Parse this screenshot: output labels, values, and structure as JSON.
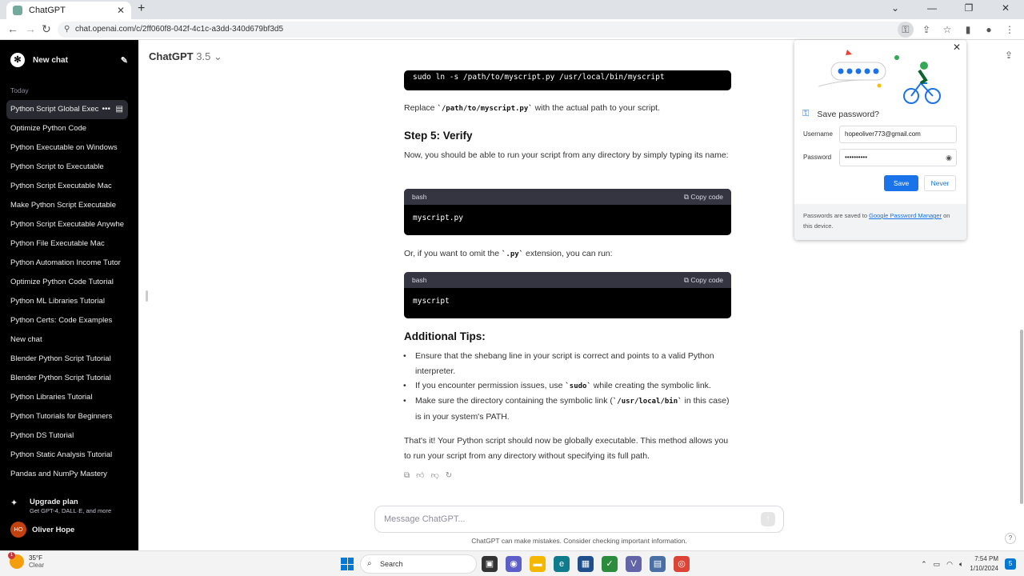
{
  "browser": {
    "tab_title": "ChatGPT",
    "url": "chat.openai.com/c/2ff060f8-042f-4c1c-a3dd-340d679bf3d5"
  },
  "sidebar": {
    "new_chat": "New chat",
    "section_today": "Today",
    "chats": [
      "Python Script Global Exec",
      "Optimize Python Code",
      "Python Executable on Windows",
      "Python Script to Executable",
      "Python Script Executable Mac",
      "Make Python Script Executable",
      "Python Script Executable Anywhe",
      "Python File Executable Mac",
      "Python Automation Income Tutor",
      "Optimize Python Code Tutorial",
      "Python ML Libraries Tutorial",
      "Python Certs: Code Examples",
      "New chat",
      "Blender Python Script Tutorial",
      "Blender Python Script Tutorial",
      "Python Libraries Tutorial",
      "Python Tutorials for Beginners",
      "Python DS Tutorial",
      "Python Static Analysis Tutorial",
      "Pandas and NumPy Mastery"
    ],
    "upgrade_title": "Upgrade plan",
    "upgrade_sub": "Get GPT-4, DALL·E, and more",
    "user_initials": "HO",
    "user_name": "Oliver Hope"
  },
  "header": {
    "model": "ChatGPT",
    "version": "3.5"
  },
  "content": {
    "code1": "sudo ln -s /path/to/myscript.py /usr/local/bin/myscript",
    "replace_pre": "Replace ",
    "replace_code": "`/path/to/myscript.py`",
    "replace_post": " with the actual path to your script.",
    "step5": "Step 5: Verify",
    "verify_text": "Now, you should be able to run your script from any directory by simply typing its name:",
    "lang": "bash",
    "copy_label": "Copy code",
    "code2": "myscript.py",
    "omit_pre": "Or, if you want to omit the ",
    "omit_code": "`.py`",
    "omit_post": " extension, you can run:",
    "code3": "myscript",
    "tips_heading": "Additional Tips:",
    "tip1": "Ensure that the shebang line in your script is correct and points to a valid Python interpreter.",
    "tip2_pre": "If you encounter permission issues, use ",
    "tip2_code": "`sudo`",
    "tip2_post": " while creating the symbolic link.",
    "tip3_pre": "Make sure the directory containing the symbolic link (",
    "tip3_code": "`/usr/local/bin`",
    "tip3_post": " in this case) is in your system's PATH.",
    "conclusion": "That's it! Your Python script should now be globally executable. This method allows you to run your script from any directory without specifying its full path."
  },
  "composer": {
    "placeholder": "Message ChatGPT...",
    "disclaimer": "ChatGPT can make mistakes. Consider checking important information."
  },
  "password_popup": {
    "title": "Save password?",
    "username_label": "Username",
    "username_value": "hopeoliver773@gmail.com",
    "password_label": "Password",
    "password_value": "••••••••••",
    "save": "Save",
    "never": "Never",
    "footer_pre": "Passwords are saved to ",
    "footer_link": "Google Password Manager",
    "footer_post": " on this device."
  },
  "taskbar": {
    "temp": "35°F",
    "weather": "Clear",
    "weather_badge": "1",
    "search": "Search",
    "time": "7:54 PM",
    "date": "1/10/2024",
    "notif_count": "5"
  },
  "colors": {
    "accent": "#1a73e8",
    "sidebar_bg": "#000000",
    "code_header": "#343541"
  }
}
